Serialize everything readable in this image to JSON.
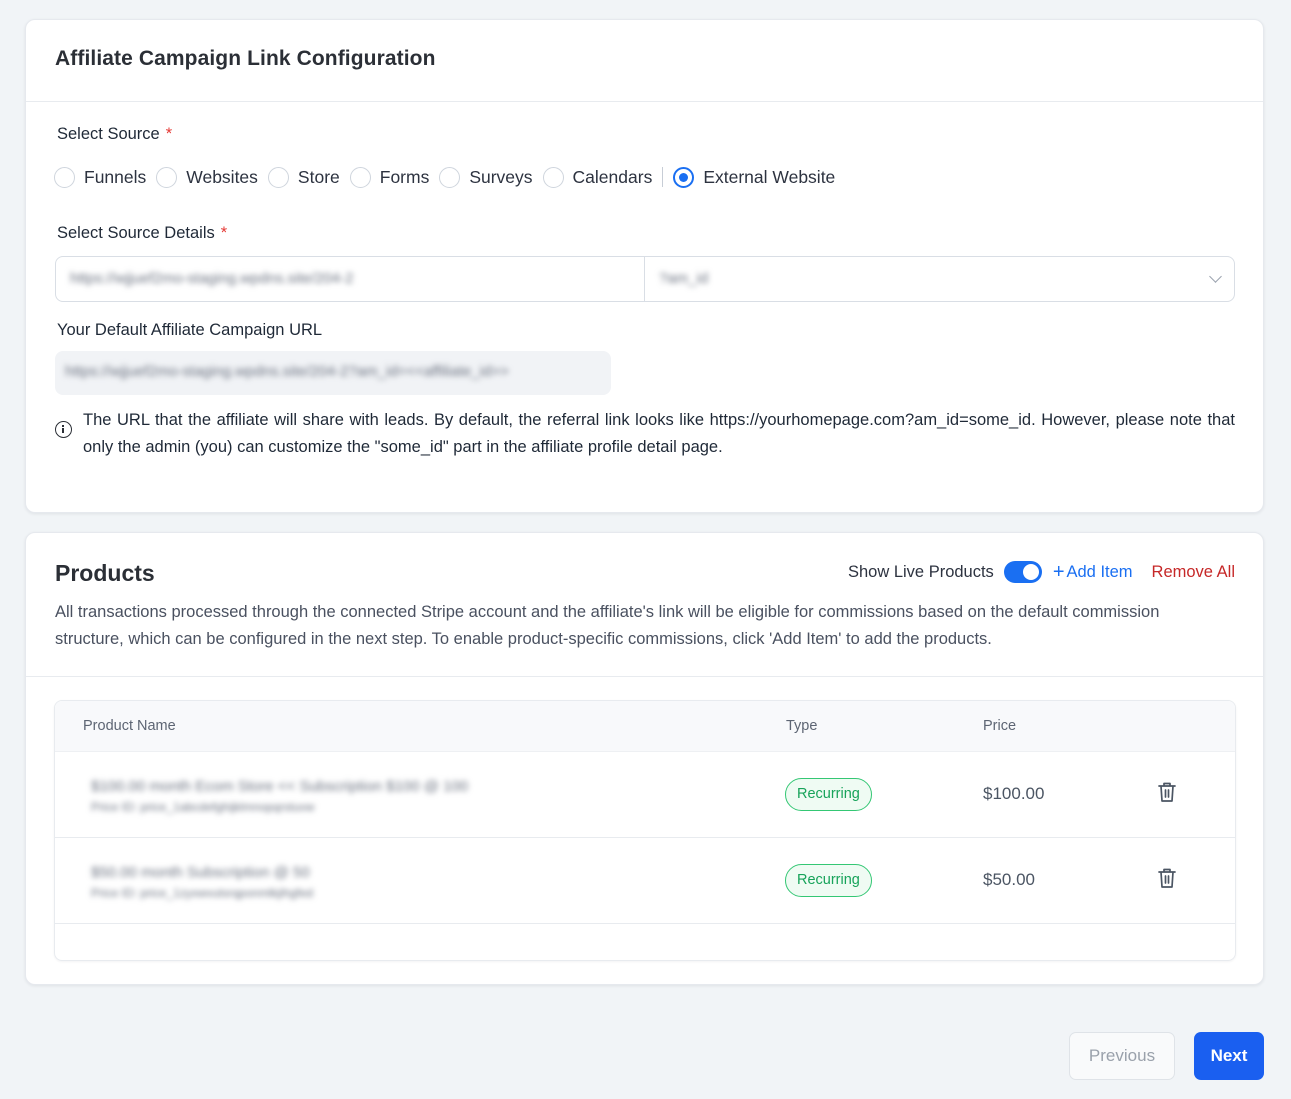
{
  "config_card": {
    "title": "Affiliate Campaign Link Configuration",
    "select_source_label": "Select Source",
    "required_mark": "*",
    "sources": [
      {
        "label": "Funnels",
        "checked": false
      },
      {
        "label": "Websites",
        "checked": false
      },
      {
        "label": "Store",
        "checked": false
      },
      {
        "label": "Forms",
        "checked": false
      },
      {
        "label": "Surveys",
        "checked": false
      },
      {
        "label": "Calendars",
        "checked": false
      },
      {
        "label": "External Website",
        "checked": true
      }
    ],
    "source_details_label": "Select Source Details",
    "source_url_value": "https://wjjuef2mo-staging.wpdns.site/204-2",
    "source_param_value": "?am_id",
    "default_url_label": "Your Default Affiliate Campaign URL",
    "default_url_value": "https://wjjuef2mo-staging.wpdns.site/204-2?am_id=<<affiliate_id>>",
    "info_text": "The URL that the affiliate will share with leads. By default, the referral link looks like https://yourhomepage.com?am_id=some_id. However, please note that only the admin (you) can customize the \"some_id\" part in the affiliate profile detail page."
  },
  "products_card": {
    "title": "Products",
    "show_live_label": "Show Live Products",
    "show_live_enabled": true,
    "add_item_label": "Add Item",
    "remove_all_label": "Remove All",
    "description": "All transactions processed through the connected Stripe account and the affiliate's link will be eligible for commissions based on the default commission structure, which can be configured in the next step. To enable product-specific commissions, click 'Add Item' to add the products.",
    "columns": {
      "name": "Product Name",
      "type": "Type",
      "price": "Price"
    },
    "rows": [
      {
        "name": "$100.00 month Ecom Store << Subscription $100 @ 100",
        "price_id": "Price ID: price_1abcdefghijklmnopqrstuvw",
        "type": "Recurring",
        "price": "$100.00"
      },
      {
        "name": "$50.00 month Subscription @ 50",
        "price_id": "Price ID: price_1zyxwvutsrqponmlkjihgfed",
        "type": "Recurring",
        "price": "$50.00"
      }
    ]
  },
  "footer": {
    "previous_label": "Previous",
    "next_label": "Next"
  },
  "colors": {
    "accent": "#1a6ff2",
    "danger": "#c62828",
    "success": "#17a35a"
  }
}
